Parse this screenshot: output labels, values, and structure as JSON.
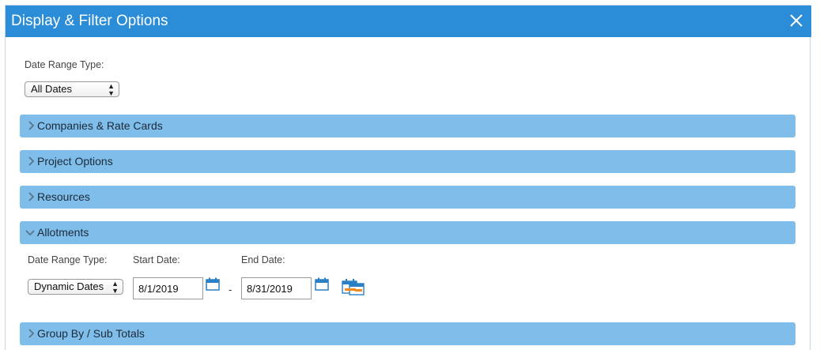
{
  "dialog": {
    "title": "Display & Filter Options",
    "close_icon": "close-icon"
  },
  "date_range": {
    "label": "Date Range Type:",
    "selected": "All Dates"
  },
  "sections": [
    {
      "label": "Companies & Rate Cards",
      "expanded": false
    },
    {
      "label": "Project Options",
      "expanded": false
    },
    {
      "label": "Resources",
      "expanded": false
    },
    {
      "label": "Allotments",
      "expanded": true
    },
    {
      "label": "Group By / Sub Totals",
      "expanded": false
    }
  ],
  "allotments": {
    "range_type_label": "Date Range Type:",
    "start_label": "Start Date:",
    "end_label": "End Date:",
    "range_type_selected": "Dynamic Dates",
    "start_date": "8/1/2019",
    "end_date": "8/31/2019",
    "separator": "-"
  },
  "colors": {
    "titlebar": "#2b8dd8",
    "section_bar": "#7fbdea"
  }
}
